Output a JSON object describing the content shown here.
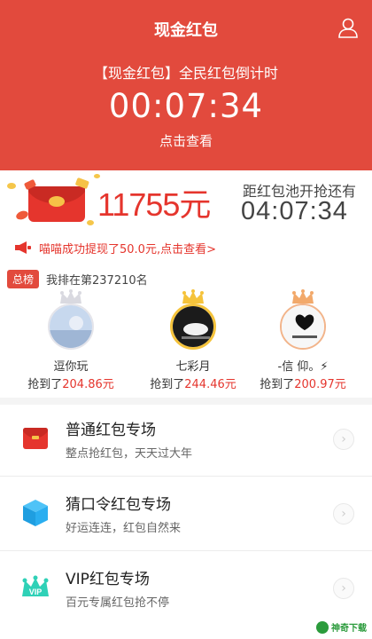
{
  "header": {
    "title": "现金红包",
    "subtitle": "【现金红包】全民红包倒计时",
    "countdown": "00:07:34",
    "link": "点击查看",
    "icons": {
      "user": "user-icon"
    }
  },
  "jackpot": {
    "amount": "11755元",
    "pool_label": "距红包池开抢还有",
    "pool_countdown": "04:07:34"
  },
  "notice": {
    "text": "喵喵成功提现了50.0元,点击查看>"
  },
  "ranking": {
    "badge": "总榜",
    "my_rank": "我排在第237210名",
    "winners": [
      {
        "name": "逗你玩",
        "prefix": "抢到了",
        "amount": "204.86元",
        "crown": "silver"
      },
      {
        "name": "七彩月",
        "prefix": "抢到了",
        "amount": "244.46元",
        "crown": "gold"
      },
      {
        "name": "-信 仰。⚡",
        "prefix": "抢到了",
        "amount": "200.97元",
        "crown": "bronze"
      }
    ]
  },
  "sections": [
    {
      "title": "普通红包专场",
      "desc": "整点抢红包，天天过大年",
      "icon": "red-envelope-icon"
    },
    {
      "title": "猜口令红包专场",
      "desc": "好运连连，红包自然来",
      "icon": "blue-cube-icon"
    },
    {
      "title": "VIP红包专场",
      "desc": "百元专属红包抢不停",
      "icon": "vip-crown-icon"
    }
  ],
  "watermark": "神奇下载",
  "colors": {
    "primary": "#e24a3d",
    "accent": "#e5352d"
  }
}
